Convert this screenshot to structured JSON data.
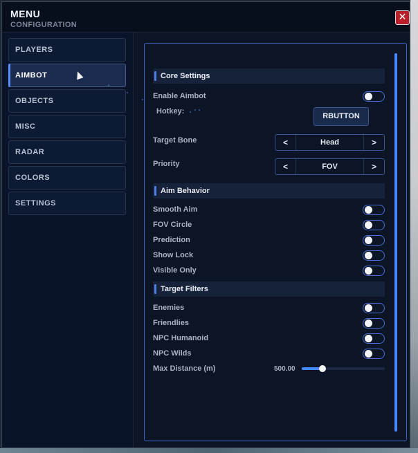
{
  "window": {
    "title": "MENU",
    "subtitle": "CONFIGURATION",
    "close_icon": "close-icon",
    "close_glyph": "✕"
  },
  "sidebar": {
    "items": [
      {
        "label": "PLAYERS",
        "active": false
      },
      {
        "label": "AIMBOT",
        "active": true
      },
      {
        "label": "OBJECTS",
        "active": false
      },
      {
        "label": "MISC",
        "active": false
      },
      {
        "label": "RADAR",
        "active": false
      },
      {
        "label": "COLORS",
        "active": false
      },
      {
        "label": "SETTINGS",
        "active": false
      }
    ]
  },
  "panel": {
    "core": {
      "title": "Core Settings",
      "enable_aimbot": {
        "label": "Enable Aimbot",
        "on": false
      },
      "hotkey": {
        "label": "Hotkey:",
        "button": "RBUTTON"
      },
      "target_bone": {
        "label": "Target Bone",
        "value": "Head",
        "prev": "<",
        "next": ">"
      },
      "priority": {
        "label": "Priority",
        "value": "FOV",
        "prev": "<",
        "next": ">"
      }
    },
    "aim": {
      "title": "Aim Behavior",
      "smooth_aim": {
        "label": "Smooth Aim",
        "on": false
      },
      "fov_circle": {
        "label": "FOV Circle",
        "on": false
      },
      "prediction": {
        "label": "Prediction",
        "on": false
      },
      "show_lock": {
        "label": "Show Lock",
        "on": false
      },
      "visible_only": {
        "label": "Visible Only",
        "on": false
      }
    },
    "filters": {
      "title": "Target Filters",
      "enemies": {
        "label": "Enemies",
        "on": false
      },
      "friendlies": {
        "label": "Friendlies",
        "on": false
      },
      "npc_humanoid": {
        "label": "NPC Humanoid",
        "on": false
      },
      "npc_wilds": {
        "label": "NPC Wilds",
        "on": false
      },
      "max_distance": {
        "label": "Max Distance (m)",
        "value_text": "500.00",
        "fraction": 0.25
      }
    }
  },
  "colors": {
    "accent": "#4a86ff",
    "panel_border": "#3d64c4",
    "close_button": "#b8202a"
  }
}
